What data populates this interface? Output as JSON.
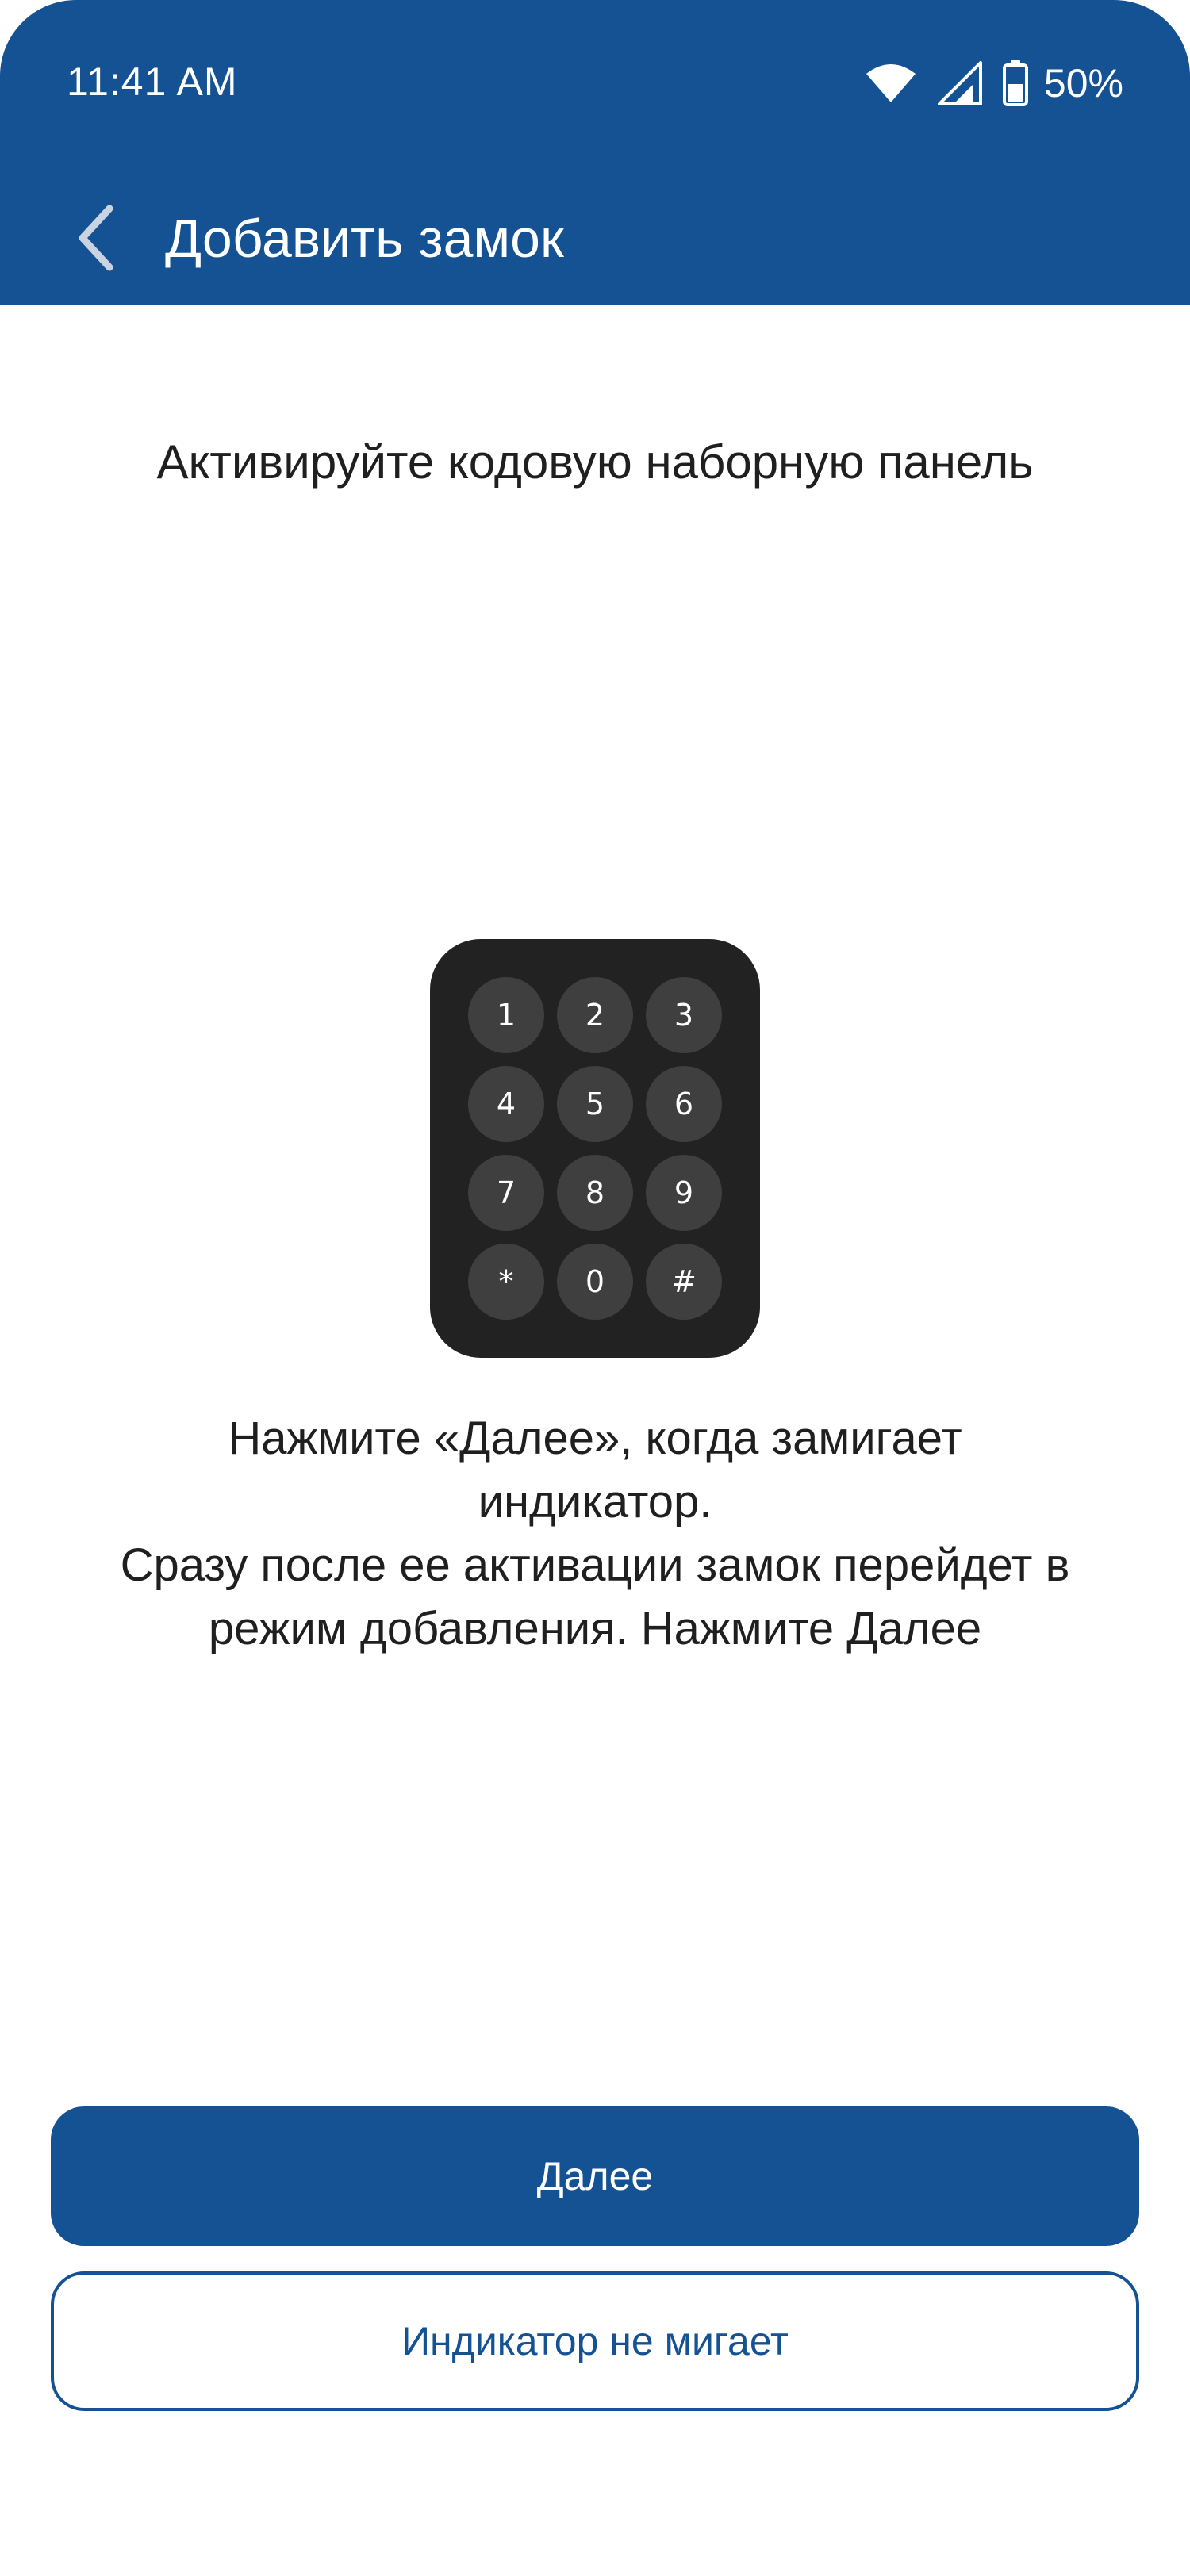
{
  "status_bar": {
    "time": "11:41 AM",
    "battery_percent": "50%",
    "icons": [
      "wifi-icon",
      "cellular-signal-icon",
      "battery-icon"
    ]
  },
  "app_bar": {
    "title": "Добавить замок",
    "back_icon": "chevron-left-icon"
  },
  "content": {
    "heading": "Активируйте кодовую наборную панель",
    "keypad": {
      "keys": [
        "1",
        "2",
        "3",
        "4",
        "5",
        "6",
        "7",
        "8",
        "9",
        "*",
        "0",
        "#"
      ]
    },
    "instructions": {
      "line1": "Нажмите «Далее», когда замигает",
      "line2": "индикатор.",
      "line3": "Сразу после ее активации замок перейдет в",
      "line4": "режим добавления. Нажмите Далее"
    }
  },
  "actions": {
    "next_label": "Далее",
    "no_blink_label": "Индикатор не мигает"
  },
  "colors": {
    "primary": "#155293",
    "keypad_body": "#222222",
    "keypad_key": "#3f3f3f",
    "text": "#1f1f1f",
    "background": "#ffffff"
  }
}
